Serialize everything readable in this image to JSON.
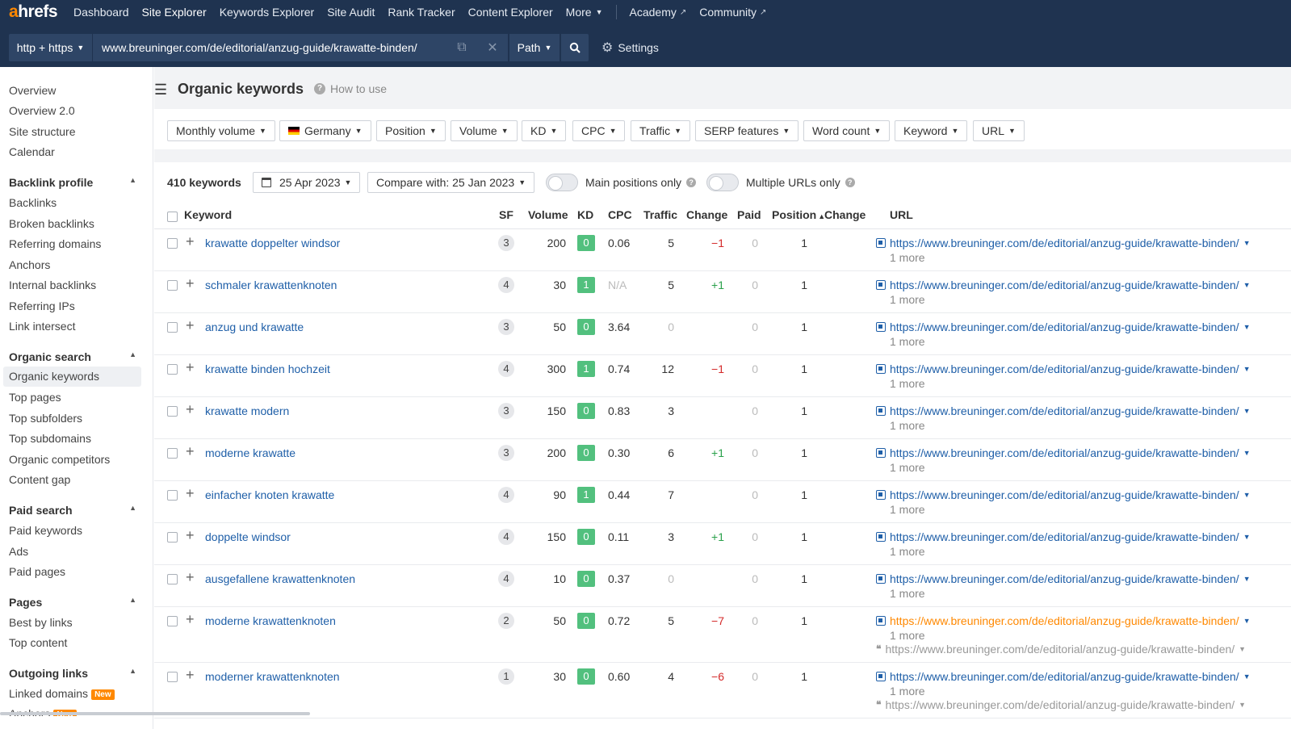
{
  "topnav": {
    "logo_a": "a",
    "logo_rest": "hrefs",
    "items": [
      {
        "label": "Dashboard"
      },
      {
        "label": "Site Explorer"
      },
      {
        "label": "Keywords Explorer"
      },
      {
        "label": "Site Audit"
      },
      {
        "label": "Rank Tracker"
      },
      {
        "label": "Content Explorer"
      },
      {
        "label": "More"
      },
      {
        "label": "Academy"
      },
      {
        "label": "Community"
      }
    ]
  },
  "searchbar": {
    "protocol": "http + https",
    "url": "www.breuninger.com/de/editorial/anzug-guide/krawatte-binden/",
    "mode": "Path",
    "settings_label": "Settings"
  },
  "sidebar": {
    "top": [
      "Overview",
      "Overview 2.0",
      "Site structure",
      "Calendar"
    ],
    "backlink_title": "Backlink profile",
    "backlink": [
      "Backlinks",
      "Broken backlinks",
      "Referring domains",
      "Anchors",
      "Internal backlinks",
      "Referring IPs",
      "Link intersect"
    ],
    "organic_title": "Organic search",
    "organic": [
      "Organic keywords",
      "Top pages",
      "Top subfolders",
      "Top subdomains",
      "Organic competitors",
      "Content gap"
    ],
    "paid_title": "Paid search",
    "paid": [
      "Paid keywords",
      "Ads",
      "Paid pages"
    ],
    "pages_title": "Pages",
    "pages": [
      "Best by links",
      "Top content"
    ],
    "outgoing_title": "Outgoing links",
    "outgoing": [
      "Linked domains",
      "Anchors"
    ],
    "new_badge": "New"
  },
  "main": {
    "title": "Organic keywords",
    "how_to_use": "How to use",
    "filters": [
      "Monthly volume",
      "Germany",
      "Position",
      "Volume",
      "KD",
      "CPC",
      "Traffic",
      "SERP features",
      "Word count",
      "Keyword",
      "URL"
    ],
    "keyword_count": "410 keywords",
    "date": "25 Apr 2023",
    "compare": "Compare with: 25 Jan 2023",
    "toggle_main": "Main positions only",
    "toggle_multi": "Multiple URLs only"
  },
  "table": {
    "headers": {
      "keyword": "Keyword",
      "sf": "SF",
      "volume": "Volume",
      "kd": "KD",
      "cpc": "CPC",
      "traffic": "Traffic",
      "change": "Change",
      "paid": "Paid",
      "position": "Position",
      "pos_change": "Change",
      "url": "URL"
    },
    "url_text": "https://www.breuninger.com/de/editorial/anzug-guide/krawatte-binden/",
    "more_text": "1 more",
    "rows": [
      {
        "keyword": "krawatte doppelter windsor",
        "sf": "3",
        "volume": "200",
        "kd": "0",
        "cpc": "0.06",
        "traffic": "5",
        "change": "−1",
        "paid": "0",
        "position": "1"
      },
      {
        "keyword": "schmaler krawattenknoten",
        "sf": "4",
        "volume": "30",
        "kd": "1",
        "cpc": "N/A",
        "traffic": "5",
        "change": "+1",
        "paid": "0",
        "position": "1"
      },
      {
        "keyword": "anzug und krawatte",
        "sf": "3",
        "volume": "50",
        "kd": "0",
        "cpc": "3.64",
        "traffic": "0",
        "change": "",
        "paid": "0",
        "position": "1"
      },
      {
        "keyword": "krawatte binden hochzeit",
        "sf": "4",
        "volume": "300",
        "kd": "1",
        "cpc": "0.74",
        "traffic": "12",
        "change": "−1",
        "paid": "0",
        "position": "1"
      },
      {
        "keyword": "krawatte modern",
        "sf": "3",
        "volume": "150",
        "kd": "0",
        "cpc": "0.83",
        "traffic": "3",
        "change": "",
        "paid": "0",
        "position": "1"
      },
      {
        "keyword": "moderne krawatte",
        "sf": "3",
        "volume": "200",
        "kd": "0",
        "cpc": "0.30",
        "traffic": "6",
        "change": "+1",
        "paid": "0",
        "position": "1"
      },
      {
        "keyword": "einfacher knoten krawatte",
        "sf": "4",
        "volume": "90",
        "kd": "1",
        "cpc": "0.44",
        "traffic": "7",
        "change": "",
        "paid": "0",
        "position": "1"
      },
      {
        "keyword": "doppelte windsor",
        "sf": "4",
        "volume": "150",
        "kd": "0",
        "cpc": "0.11",
        "traffic": "3",
        "change": "+1",
        "paid": "0",
        "position": "1"
      },
      {
        "keyword": "ausgefallene krawattenknoten",
        "sf": "4",
        "volume": "10",
        "kd": "0",
        "cpc": "0.37",
        "traffic": "0",
        "change": "",
        "paid": "0",
        "position": "1"
      },
      {
        "keyword": "moderne krawattenknoten",
        "sf": "2",
        "volume": "50",
        "kd": "0",
        "cpc": "0.72",
        "traffic": "5",
        "change": "−7",
        "paid": "0",
        "position": "1"
      },
      {
        "keyword": "moderner krawattenknoten",
        "sf": "1",
        "volume": "30",
        "kd": "0",
        "cpc": "0.60",
        "traffic": "4",
        "change": "−6",
        "paid": "0",
        "position": "1"
      }
    ]
  }
}
